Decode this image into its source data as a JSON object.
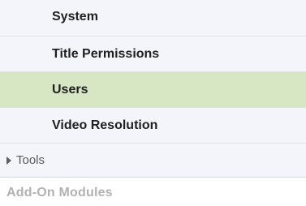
{
  "sidebar": {
    "items": [
      {
        "label": "System"
      },
      {
        "label": "Title Permissions"
      },
      {
        "label": "Users",
        "active": true
      },
      {
        "label": "Video Resolution"
      }
    ],
    "tools": {
      "label": "Tools",
      "expanded": false
    },
    "addon_modules": {
      "label": "Add-On Modules"
    }
  },
  "colors": {
    "active_item_bg": "#d7e6c3",
    "item_bg": "#f3f5fa",
    "header_text": "#b2b2b2"
  }
}
